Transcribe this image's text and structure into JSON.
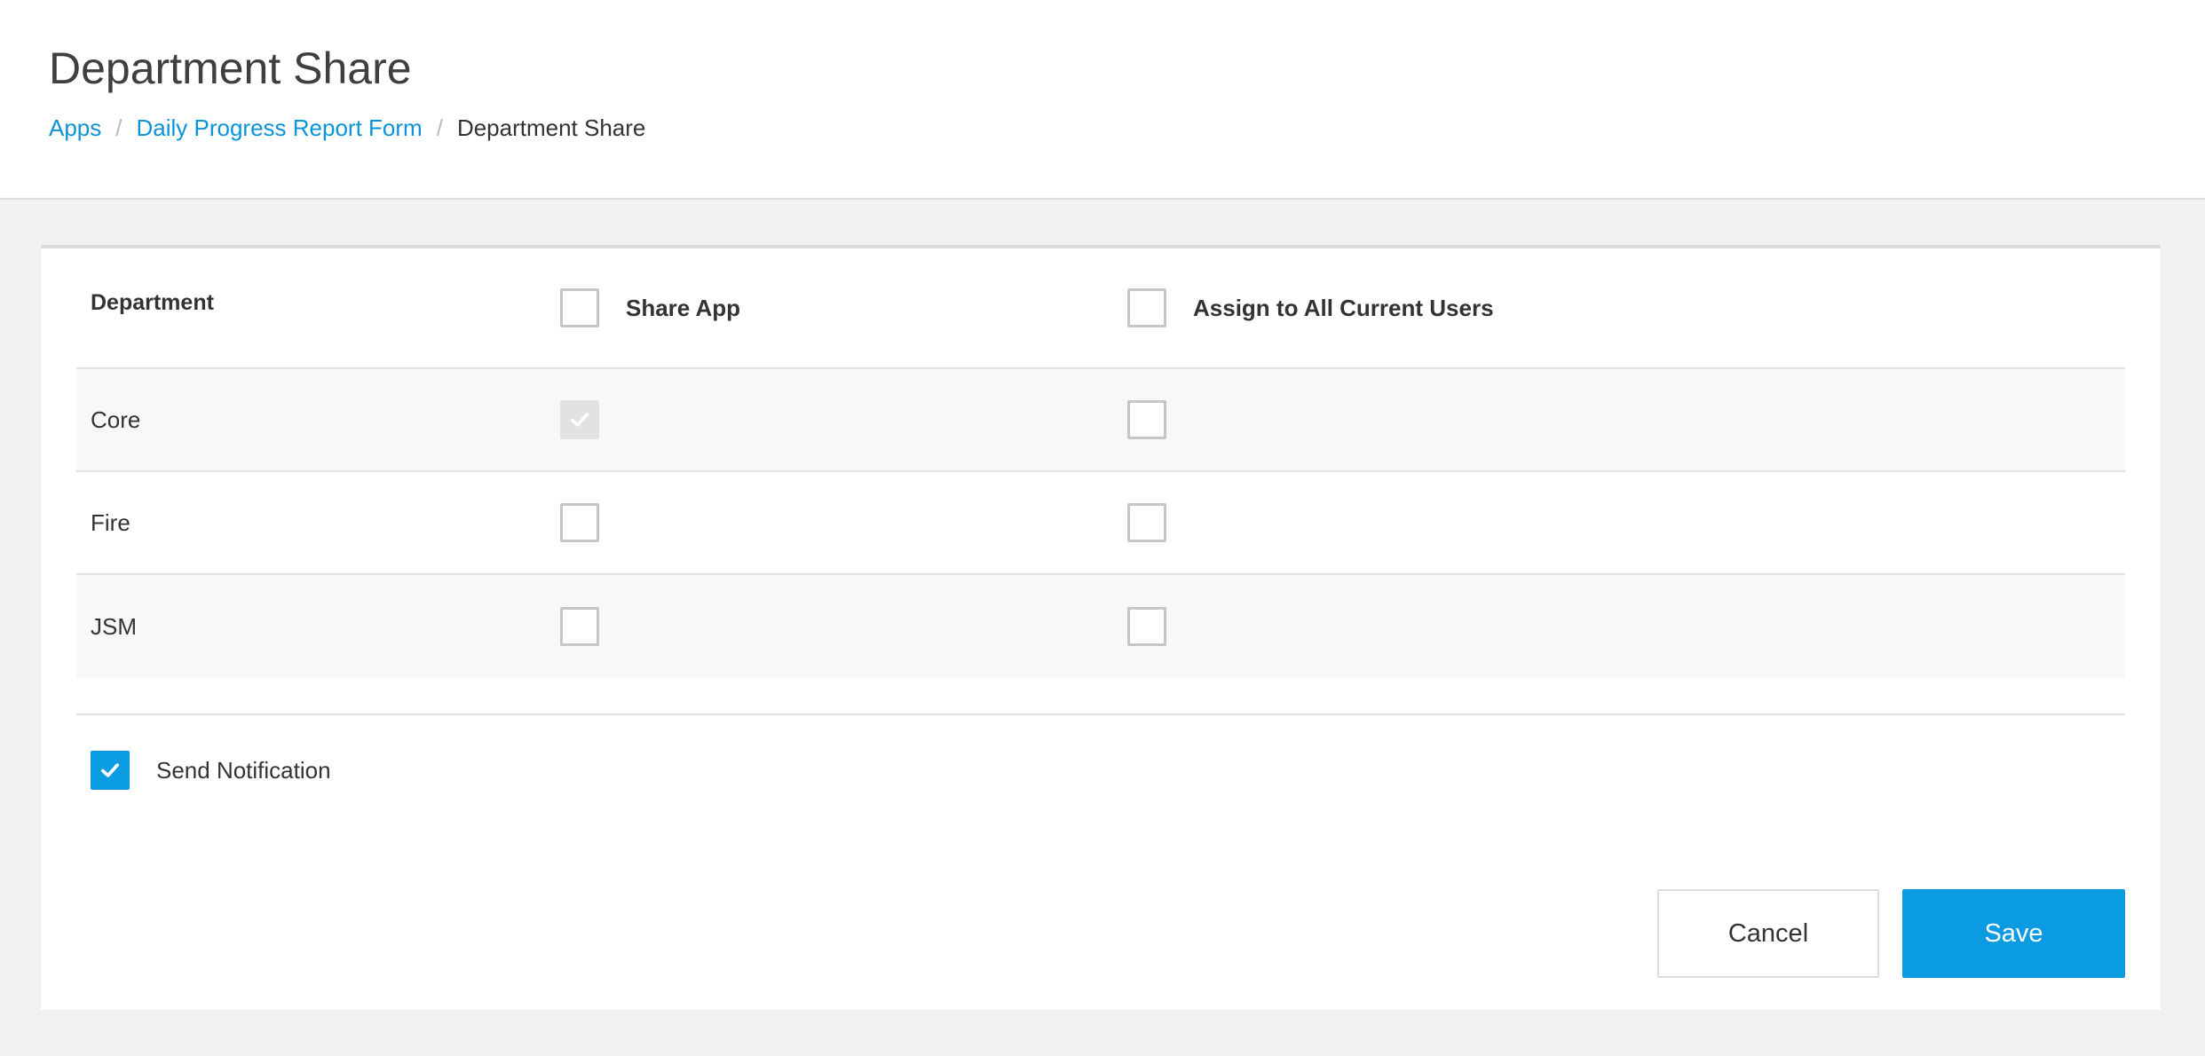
{
  "header": {
    "title": "Department Share",
    "breadcrumb": [
      {
        "label": "Apps",
        "link": true
      },
      {
        "label": "Daily Progress Report Form",
        "link": true
      },
      {
        "label": "Department Share",
        "link": false
      }
    ],
    "separator": "/"
  },
  "table": {
    "columns": {
      "department": "Department",
      "share_app": "Share App",
      "assign_all": "Assign to All Current Users"
    },
    "header_checkboxes": {
      "share_app": false,
      "assign_all": false
    },
    "rows": [
      {
        "department": "Core",
        "share_app": true,
        "share_app_disabled": true,
        "assign_all": false
      },
      {
        "department": "Fire",
        "share_app": false,
        "share_app_disabled": false,
        "assign_all": false
      },
      {
        "department": "JSM",
        "share_app": false,
        "share_app_disabled": false,
        "assign_all": false
      }
    ]
  },
  "notification": {
    "label": "Send Notification",
    "checked": true
  },
  "actions": {
    "cancel_label": "Cancel",
    "save_label": "Save"
  },
  "colors": {
    "accent": "#0b9be3",
    "link": "#0b93d9",
    "page_background": "#f2f2f2",
    "alt_row": "#f8f8f8",
    "disabled_checkbox": "#e2e2e2"
  }
}
